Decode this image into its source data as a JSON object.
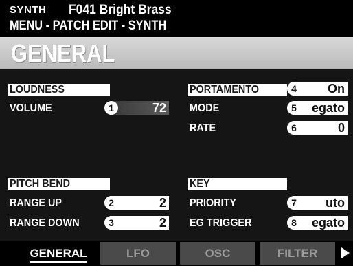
{
  "header": {
    "mode": "SYNTH",
    "patch": "F041 Bright Brass",
    "path": "MENU - PATCH EDIT - SYNTH"
  },
  "title": "GENERAL",
  "sections": {
    "loudness": {
      "label": "LOUDNESS",
      "volume": {
        "label": "VOLUME",
        "num": "1",
        "value": "72"
      }
    },
    "portamento": {
      "label": "PORTAMENTO",
      "switch": {
        "num": "4",
        "value": "On"
      },
      "mode": {
        "label": "MODE",
        "num": "5",
        "value": "egato"
      },
      "rate": {
        "label": "RATE",
        "num": "6",
        "value": "0"
      }
    },
    "pitch_bend": {
      "label": "PITCH BEND",
      "range_up": {
        "label": "RANGE UP",
        "num": "2",
        "value": "2"
      },
      "range_down": {
        "label": "RANGE DOWN",
        "num": "3",
        "value": "2"
      }
    },
    "key": {
      "label": "KEY",
      "priority": {
        "label": "PRIORITY",
        "num": "7",
        "value": "uto"
      },
      "eg_trigger": {
        "label": "EG TRIGGER",
        "num": "8",
        "value": "egato"
      }
    }
  },
  "tabs": [
    {
      "label": "GENERAL",
      "active": true
    },
    {
      "label": "LFO",
      "active": false
    },
    {
      "label": "OSC",
      "active": false
    },
    {
      "label": "FILTER",
      "active": false
    }
  ],
  "more_icon": "right-arrow-icon"
}
